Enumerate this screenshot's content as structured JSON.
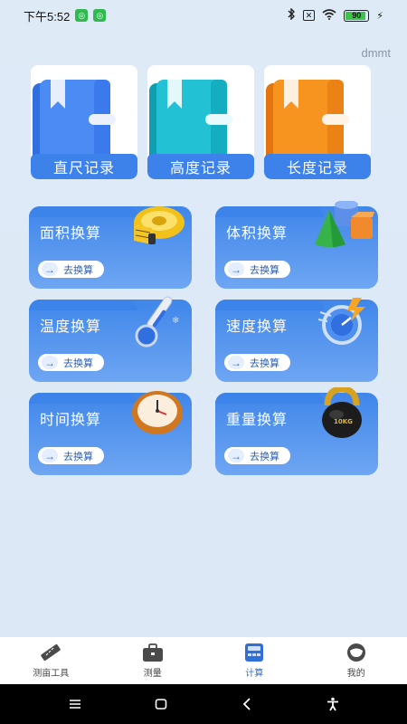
{
  "status_bar": {
    "time": "下午5:52",
    "battery_level": "90",
    "sim_icon": "sim-x-icon"
  },
  "user": {
    "name": "dmmt"
  },
  "records": [
    {
      "label": "直尺记录",
      "color": "#3d82ea",
      "icon": "blue-notebook-icon"
    },
    {
      "label": "高度记录",
      "color": "#16b6c8",
      "icon": "cyan-notebook-icon"
    },
    {
      "label": "长度记录",
      "color": "#f08a1c",
      "icon": "orange-notebook-icon"
    }
  ],
  "conversions": [
    {
      "title": "面积换算",
      "button": "去换算",
      "icon": "tape-measure-icon"
    },
    {
      "title": "体积换算",
      "button": "去换算",
      "icon": "3d-shapes-icon"
    },
    {
      "title": "温度换算",
      "button": "去换算",
      "icon": "thermometer-icon"
    },
    {
      "title": "速度换算",
      "button": "去换算",
      "icon": "speedometer-icon"
    },
    {
      "title": "时间换算",
      "button": "去换算",
      "icon": "clock-icon"
    },
    {
      "title": "重量换算",
      "button": "去换算",
      "icon": "kettlebell-icon"
    }
  ],
  "kettlebell_text": "10KG",
  "bottom_nav": [
    {
      "label": "测亩工具",
      "icon": "ruler-icon",
      "active": false
    },
    {
      "label": "测量",
      "icon": "toolbox-icon",
      "active": false
    },
    {
      "label": "计算",
      "icon": "calculator-icon",
      "active": true
    },
    {
      "label": "我的",
      "icon": "profile-icon",
      "active": false
    }
  ],
  "colors": {
    "primary": "#3d82ea",
    "background": "#dfeaf7"
  }
}
